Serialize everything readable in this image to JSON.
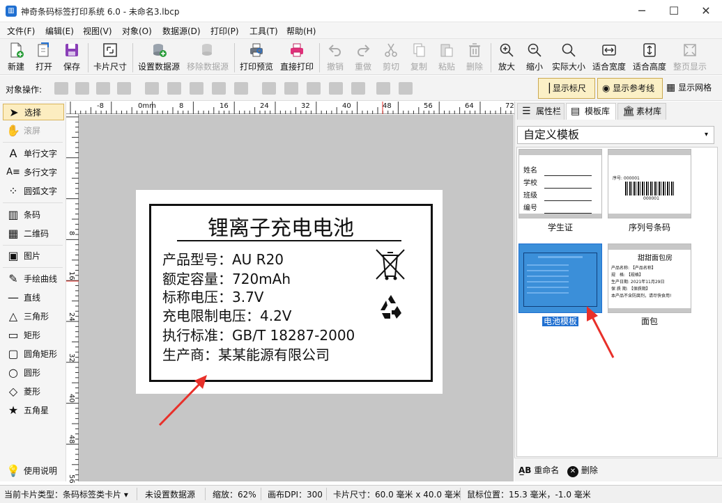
{
  "window": {
    "title": "神奇条码标签打印系统 6.0 - 未命名3.lbcp",
    "app_icon": "barcode-app-icon",
    "minimize": "─",
    "maximize": "☐",
    "close": "✕"
  },
  "menu": [
    "文件(F)",
    "编辑(E)",
    "视图(V)",
    "对象(O)",
    "数据源(D)",
    "打印(P)",
    "工具(T)",
    "帮助(H)"
  ],
  "toolbar": [
    {
      "label": "新建",
      "icon": "new-file-icon",
      "enabled": true
    },
    {
      "label": "打开",
      "icon": "open-icon",
      "enabled": true
    },
    {
      "label": "保存",
      "icon": "save-icon",
      "enabled": true
    },
    {
      "label": "卡片尺寸",
      "icon": "card-size-icon",
      "enabled": true
    },
    {
      "label": "设置数据源",
      "icon": "set-datasource-icon",
      "enabled": true
    },
    {
      "label": "移除数据源",
      "icon": "remove-datasource-icon",
      "enabled": false
    },
    {
      "label": "打印预览",
      "icon": "print-preview-icon",
      "enabled": true
    },
    {
      "label": "直接打印",
      "icon": "printer-icon",
      "enabled": true
    },
    {
      "label": "撤销",
      "icon": "undo-icon",
      "enabled": false
    },
    {
      "label": "重做",
      "icon": "redo-icon",
      "enabled": false
    },
    {
      "label": "剪切",
      "icon": "cut-icon",
      "enabled": false
    },
    {
      "label": "复制",
      "icon": "copy-icon",
      "enabled": false
    },
    {
      "label": "粘贴",
      "icon": "paste-icon",
      "enabled": false
    },
    {
      "label": "删除",
      "icon": "delete-icon",
      "enabled": false
    },
    {
      "label": "放大",
      "icon": "zoom-in-icon",
      "enabled": true
    },
    {
      "label": "缩小",
      "icon": "zoom-out-icon",
      "enabled": true
    },
    {
      "label": "实际大小",
      "icon": "actual-size-icon",
      "enabled": true
    },
    {
      "label": "适合宽度",
      "icon": "fit-width-icon",
      "enabled": true
    },
    {
      "label": "适合高度",
      "icon": "fit-height-icon",
      "enabled": true
    },
    {
      "label": "整页显示",
      "icon": "full-page-icon",
      "enabled": false
    }
  ],
  "ops": {
    "label": "对象操作:",
    "show_ruler": "显示标尺",
    "show_guides": "显示参考线",
    "show_grid": "显示网格"
  },
  "tools": [
    {
      "label": "选择",
      "icon": "pointer-icon",
      "glyph": "➤",
      "selected": true,
      "enabled": true
    },
    {
      "label": "滚屏",
      "icon": "hand-icon",
      "glyph": "✋",
      "enabled": false
    },
    {
      "label": "单行文字",
      "icon": "single-line-text-icon",
      "glyph": "A",
      "enabled": true
    },
    {
      "label": "多行文字",
      "icon": "multi-line-text-icon",
      "glyph": "A≡",
      "enabled": true
    },
    {
      "label": "圆弧文字",
      "icon": "arc-text-icon",
      "glyph": "⁘",
      "enabled": true
    },
    {
      "label": "条码",
      "icon": "barcode-icon",
      "glyph": "▥",
      "enabled": true
    },
    {
      "label": "二维码",
      "icon": "qrcode-icon",
      "glyph": "▦",
      "enabled": true
    },
    {
      "label": "图片",
      "icon": "image-icon",
      "glyph": "▣",
      "enabled": true
    },
    {
      "label": "手绘曲线",
      "icon": "pen-icon",
      "glyph": "✎",
      "enabled": true
    },
    {
      "label": "直线",
      "icon": "line-icon",
      "glyph": "—",
      "enabled": true
    },
    {
      "label": "三角形",
      "icon": "triangle-icon",
      "glyph": "△",
      "enabled": true
    },
    {
      "label": "矩形",
      "icon": "rectangle-icon",
      "glyph": "▭",
      "enabled": true
    },
    {
      "label": "圆角矩形",
      "icon": "rounded-rect-icon",
      "glyph": "▢",
      "enabled": true
    },
    {
      "label": "圆形",
      "icon": "circle-icon",
      "glyph": "○",
      "enabled": true
    },
    {
      "label": "菱形",
      "icon": "diamond-icon",
      "glyph": "◇",
      "enabled": true
    },
    {
      "label": "五角星",
      "icon": "star-icon",
      "glyph": "★",
      "enabled": true
    },
    {
      "label": "使用说明",
      "icon": "lightbulb-icon",
      "glyph": "💡",
      "enabled": true
    }
  ],
  "ruler": {
    "h_ticks": [
      "-8",
      "0mm",
      "8",
      "16",
      "24",
      "32",
      "40",
      "48",
      "56",
      "64",
      "72"
    ],
    "v_ticks": [
      "8",
      "16",
      "24",
      "32",
      "40",
      "48",
      "56"
    ]
  },
  "label": {
    "title": "锂离子充电电池",
    "lines": [
      "产品型号：AU R20",
      "额定容量：720mAh",
      "标称电压：3.7V",
      "充电限制电压：4.2V",
      "执行标准：GB/T 18287-2000",
      "生产商：某某能源有限公司"
    ],
    "icons": [
      "no-trash-bin-icon",
      "recycle-icon"
    ]
  },
  "right_panel": {
    "tabs": [
      {
        "label": "属性栏",
        "icon": "properties-icon",
        "active": false
      },
      {
        "label": "模板库",
        "icon": "template-icon",
        "active": true
      },
      {
        "label": "素材库",
        "icon": "material-library-icon",
        "active": false
      }
    ],
    "category": "自定义模板",
    "templates": [
      {
        "name": "学生证",
        "selected": false,
        "fields": [
          "姓名",
          "学校",
          "班级",
          "编号"
        ]
      },
      {
        "name": "序列号条码",
        "selected": false,
        "serial": "序号: 000001",
        "code": "000001"
      },
      {
        "name": "电池模板",
        "selected": true
      },
      {
        "name": "面包",
        "selected": false,
        "heading": "甜甜面包房",
        "rows": [
          "产品名称: 【产品名称】",
          "规　格: 【规格】",
          "生产日期: 2021年11月29日",
          "保 质 期: 【保质期】",
          "本产品不含防腐剂，请尽快食用!"
        ]
      }
    ],
    "footer": {
      "rename": "重命名",
      "delete": "删除"
    }
  },
  "status": {
    "card_type": "当前卡片类型：条码标签类卡片 ▾",
    "datasource": "未设置数据源",
    "zoom": "缩放：62%",
    "dpi": "画布DPI：300",
    "card_size": "卡片尺寸：60.0 毫米 x 40.0 毫米",
    "mouse": "鼠标位置：15.3 毫米，-1.0 毫米"
  },
  "colors": {
    "arrow": "#e8302a",
    "accent": "#1f6fd1",
    "selected_bg": "#fcedc0",
    "canvas": "#c6c6c6"
  }
}
